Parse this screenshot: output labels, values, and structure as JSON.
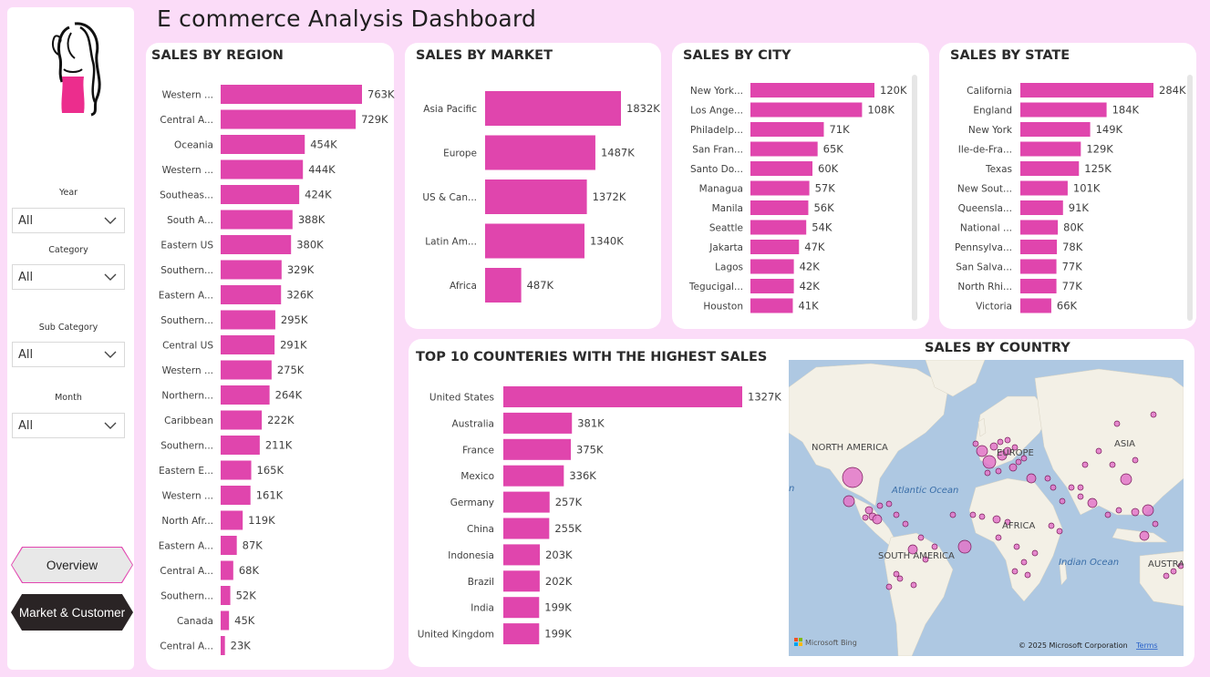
{
  "page": {
    "title": "E commerce Analysis Dashboard"
  },
  "colors": {
    "accent": "#e045ad",
    "background": "#fbdcf8",
    "nav_dark": "#2a2425"
  },
  "sidebar": {
    "logo": "woman-silhouette-logo",
    "filters": [
      {
        "label": "Year",
        "value": "All"
      },
      {
        "label": "Category",
        "value": "All"
      },
      {
        "label": "Sub Category",
        "value": "All"
      },
      {
        "label": "Month",
        "value": "All"
      }
    ],
    "nav": {
      "overview": "Overview",
      "market_customer": "Market & Customer"
    }
  },
  "chart_data": [
    {
      "id": "region",
      "type": "bar",
      "orientation": "horizontal",
      "title": "SALES BY REGION",
      "categories": [
        "Western ...",
        "Central A...",
        "Oceania",
        "Western ...",
        "Southeas...",
        "South A...",
        "Eastern US",
        "Southern...",
        "Eastern A...",
        "Southern...",
        "Central US",
        "Western ...",
        "Northern...",
        "Caribbean",
        "Southern...",
        "Eastern E...",
        "Western ...",
        "North Afr...",
        "Eastern A...",
        "Central A...",
        "Southern...",
        "Canada",
        "Central A..."
      ],
      "values": [
        763,
        729,
        454,
        444,
        424,
        388,
        380,
        329,
        326,
        295,
        291,
        275,
        264,
        222,
        211,
        165,
        161,
        119,
        87,
        68,
        52,
        45,
        23
      ],
      "labels": [
        "763K",
        "729K",
        "454K",
        "444K",
        "424K",
        "388K",
        "380K",
        "329K",
        "326K",
        "295K",
        "291K",
        "275K",
        "264K",
        "222K",
        "211K",
        "165K",
        "161K",
        "119K",
        "87K",
        "68K",
        "52K",
        "45K",
        "23K"
      ]
    },
    {
      "id": "market",
      "type": "bar",
      "orientation": "horizontal",
      "title": "SALES BY MARKET",
      "categories": [
        "Asia Pacific",
        "Europe",
        "US & Can...",
        "Latin Am...",
        "Africa"
      ],
      "values": [
        1832,
        1487,
        1372,
        1340,
        487
      ],
      "labels": [
        "1832K",
        "1487K",
        "1372K",
        "1340K",
        "487K"
      ]
    },
    {
      "id": "city",
      "type": "bar",
      "orientation": "horizontal",
      "title": "SALES BY CITY",
      "categories": [
        "New York...",
        "Los Ange...",
        "Philadelp...",
        "San Fran...",
        "Santo Do...",
        "Managua",
        "Manila",
        "Seattle",
        "Jakarta",
        "Lagos",
        "Tegucigal...",
        "Houston"
      ],
      "values": [
        120,
        108,
        71,
        65,
        60,
        57,
        56,
        54,
        47,
        42,
        42,
        41
      ],
      "labels": [
        "120K",
        "108K",
        "71K",
        "65K",
        "60K",
        "57K",
        "56K",
        "54K",
        "47K",
        "42K",
        "42K",
        "41K"
      ]
    },
    {
      "id": "state",
      "type": "bar",
      "orientation": "horizontal",
      "title": "SALES BY STATE",
      "categories": [
        "California",
        "England",
        "New York",
        "Ile-de-Fra...",
        "Texas",
        "New Sout...",
        "Queensla...",
        "National ...",
        "Pennsylva...",
        "San Salva...",
        "North Rhi...",
        "Victoria"
      ],
      "values": [
        284,
        184,
        149,
        129,
        125,
        101,
        91,
        80,
        78,
        77,
        77,
        66
      ],
      "labels": [
        "284K",
        "184K",
        "149K",
        "129K",
        "125K",
        "101K",
        "91K",
        "80K",
        "78K",
        "77K",
        "77K",
        "66K"
      ]
    },
    {
      "id": "countries",
      "type": "bar",
      "orientation": "horizontal",
      "title": "TOP 10 COUNTERIES WITH THE HIGHEST SALES",
      "categories": [
        "United States",
        "Australia",
        "France",
        "Mexico",
        "Germany",
        "China",
        "Indonesia",
        "Brazil",
        "India",
        "United Kingdom"
      ],
      "values": [
        1327,
        381,
        375,
        336,
        257,
        255,
        203,
        202,
        199,
        199
      ],
      "labels": [
        "1327K",
        "381K",
        "375K",
        "336K",
        "257K",
        "255K",
        "203K",
        "202K",
        "199K",
        "199K"
      ]
    }
  ],
  "map": {
    "title": "SALES BY COUNTRY",
    "labels": {
      "north_america": "NORTH AMERICA",
      "europe": "EUROPE",
      "asia": "ASIA",
      "africa": "AFRICA",
      "south_america": "SOUTH AMERICA",
      "atlantic": "Atlantic Ocean",
      "indian": "Indian Ocean",
      "australia": "AUSTRA",
      "pacific_fragment": "n"
    },
    "attribution": {
      "brand": "Microsoft Bing",
      "copyright": "© 2025 Microsoft Corporation",
      "terms": "Terms"
    }
  }
}
